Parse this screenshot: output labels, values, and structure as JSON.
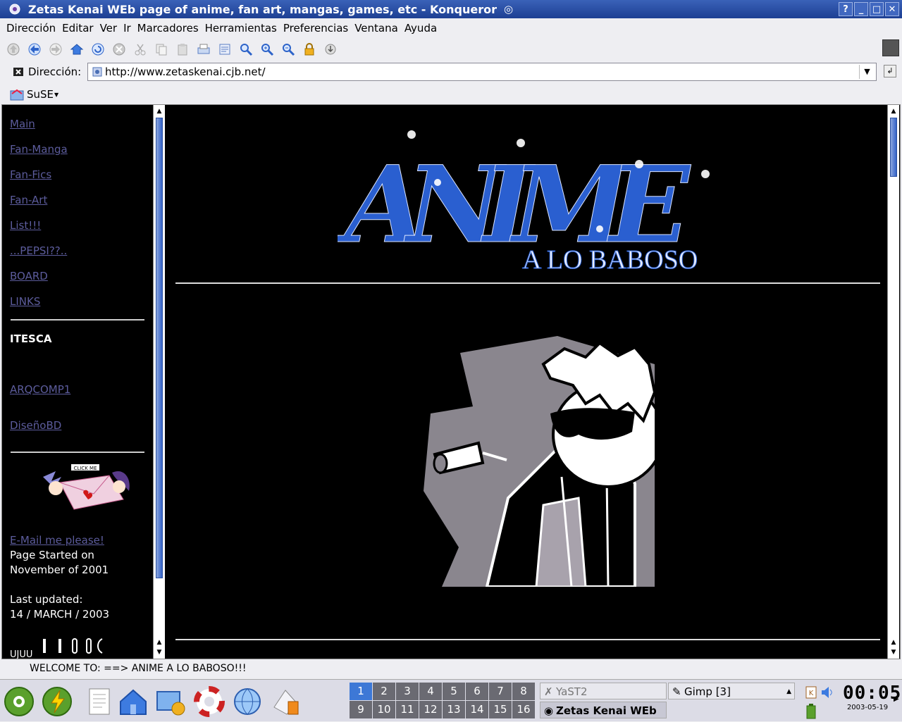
{
  "window": {
    "title": "Zetas Kenai WEb page of anime, fan art, mangas, games, etc - Konqueror",
    "buttons": [
      "?",
      "_",
      "□",
      "✕"
    ]
  },
  "menu": [
    "Dirección",
    "Editar",
    "Ver",
    "Ir",
    "Marcadores",
    "Herramientas",
    "Preferencias",
    "Ventana",
    "Ayuda"
  ],
  "toolbar": {
    "icons": [
      "up-icon",
      "back-icon",
      "forward-icon",
      "home-icon",
      "reload-icon",
      "stop-icon",
      "cut-icon",
      "copy-icon",
      "paste-icon",
      "print-icon",
      "print-frame-icon",
      "find-icon",
      "zoom-in-icon",
      "zoom-out-icon",
      "lock-icon",
      "download-icon"
    ]
  },
  "location": {
    "label": "Dirección:",
    "url": "http://www.zetaskenai.cjb.net/"
  },
  "bookmarks": {
    "item": "SuSE"
  },
  "sidebar": {
    "links": [
      "Main",
      "Fan-Manga",
      "Fan-Fics",
      "Fan-Art",
      "List!!!",
      "...PEPSI??..",
      "BOARD",
      "LINKS"
    ],
    "section_title": "ITESCA",
    "section_links": [
      "ARQCOMP1",
      "DiseñoBD"
    ],
    "mail_badge": "CLICK ME",
    "email_link": "E-Mail me please!",
    "started_line1": "Page Started on",
    "started_line2": "November of 2001",
    "updated_line1": "Last updated:",
    "updated_line2": "14 / MARCH / 2003",
    "counter": "UJUU"
  },
  "main": {
    "logo_title": "ANIME",
    "logo_subtitle": "A LO BABOSO"
  },
  "status": {
    "text": "WELCOME TO: ==> ANIME A LO BABOSO!!!"
  },
  "taskbar": {
    "pager": [
      "1",
      "2",
      "3",
      "4",
      "5",
      "6",
      "7",
      "8",
      "9",
      "10",
      "11",
      "12",
      "13",
      "14",
      "15",
      "16"
    ],
    "active_desktop": "1",
    "tasks": [
      "YaST2",
      "Gimp [3]",
      "Zetas Kenai WEb"
    ],
    "time": "00:05",
    "date": "2003-05-19"
  }
}
